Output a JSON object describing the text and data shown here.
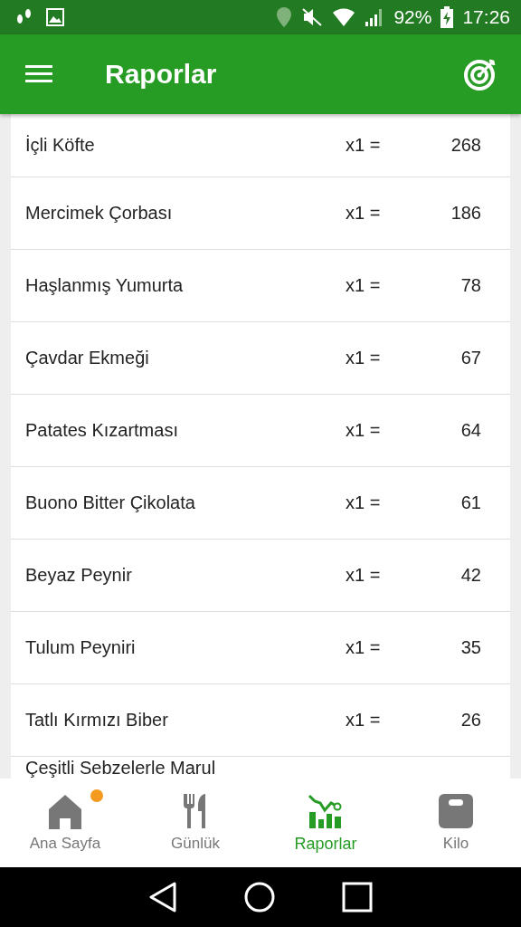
{
  "status_bar": {
    "battery": "92%",
    "time": "17:26"
  },
  "app_bar": {
    "title": "Raporlar"
  },
  "rows": [
    {
      "name": "İçli Köfte",
      "multiplier": "x1 =",
      "value": "268"
    },
    {
      "name": "Mercimek Çorbası",
      "multiplier": "x1 =",
      "value": "186"
    },
    {
      "name": "Haşlanmış Yumurta",
      "multiplier": "x1 =",
      "value": "78"
    },
    {
      "name": "Çavdar Ekmeği",
      "multiplier": "x1 =",
      "value": "67"
    },
    {
      "name": "Patates Kızartması",
      "multiplier": "x1 =",
      "value": "64"
    },
    {
      "name": "Buono Bitter Çikolata",
      "multiplier": "x1 =",
      "value": "61"
    },
    {
      "name": "Beyaz Peynir",
      "multiplier": "x1 =",
      "value": "42"
    },
    {
      "name": "Tulum Peyniri",
      "multiplier": "x1 =",
      "value": "35"
    },
    {
      "name": "Tatlı Kırmızı Biber",
      "multiplier": "x1 =",
      "value": "26"
    },
    {
      "name": "Çeşitli Sebzelerle Marul"
    }
  ],
  "bottom_nav": [
    {
      "kind": "home",
      "label": "Ana Sayfa",
      "selected": false,
      "badge": true
    },
    {
      "kind": "diary",
      "label": "Günlük",
      "selected": false,
      "badge": false
    },
    {
      "kind": "reports",
      "label": "Raporlar",
      "selected": true,
      "badge": false
    },
    {
      "kind": "weight",
      "label": "Kilo",
      "selected": false,
      "badge": false
    }
  ]
}
